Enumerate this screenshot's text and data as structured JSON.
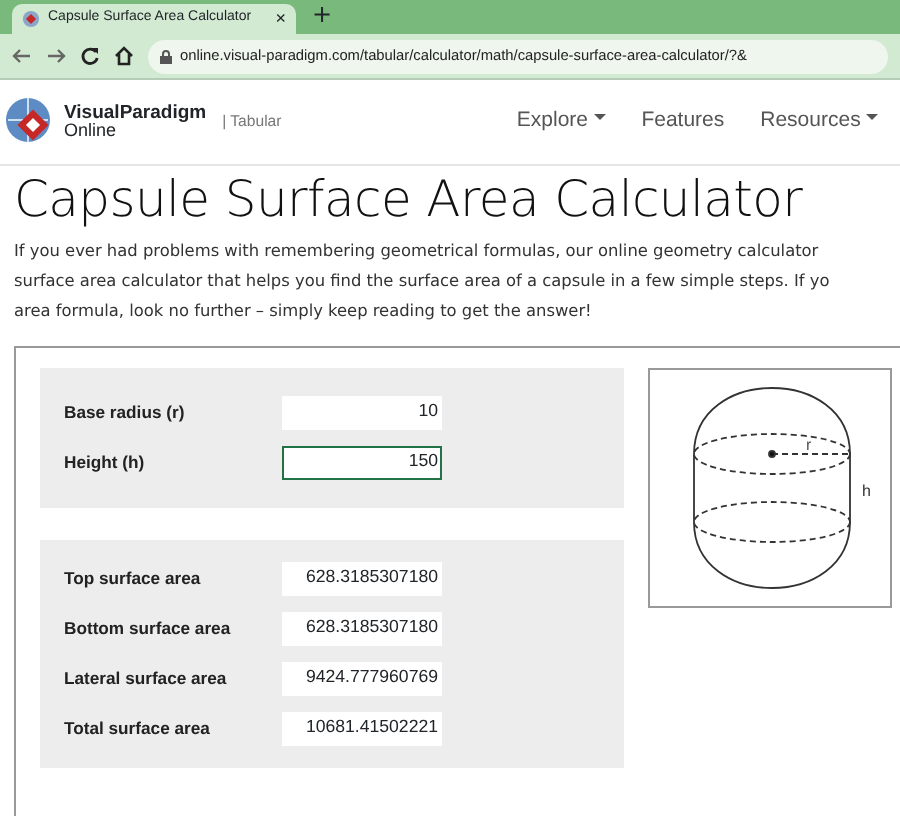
{
  "browser": {
    "tab_title": "Capsule Surface Area Calculator",
    "tab_close": "×",
    "new_tab": "+",
    "url": "online.visual-paradigm.com/tabular/calculator/math/capsule-surface-area-calculator/?&"
  },
  "navbar": {
    "brand_top": "VisualParadigm",
    "brand_bottom": "Online",
    "product": "| Tabular",
    "items": [
      {
        "label": "Explore",
        "dropdown": true
      },
      {
        "label": "Features",
        "dropdown": false
      },
      {
        "label": "Resources",
        "dropdown": true
      }
    ]
  },
  "title": "Capsule Surface Area Calculator",
  "intro_lines": [
    "If you ever had problems with remembering geometrical formulas, our online geometry calculator",
    "surface area calculator that helps you find the surface area of a capsule in a few simple steps. If yo",
    "area formula, look no further – simply keep reading to get the answer!"
  ],
  "inputs": [
    {
      "label": "Base radius (r)",
      "value": "10",
      "selected": false
    },
    {
      "label": "Height (h)",
      "value": "150",
      "selected": true
    }
  ],
  "results": [
    {
      "label": "Top surface area",
      "value": "628.3185307180"
    },
    {
      "label": "Bottom surface area",
      "value": "628.3185307180"
    },
    {
      "label": "Lateral surface area",
      "value": "9424.777960769"
    },
    {
      "label": "Total surface area",
      "value": "10681.41502221"
    }
  ],
  "diagram": {
    "radius_label": "r",
    "height_label": "h"
  }
}
